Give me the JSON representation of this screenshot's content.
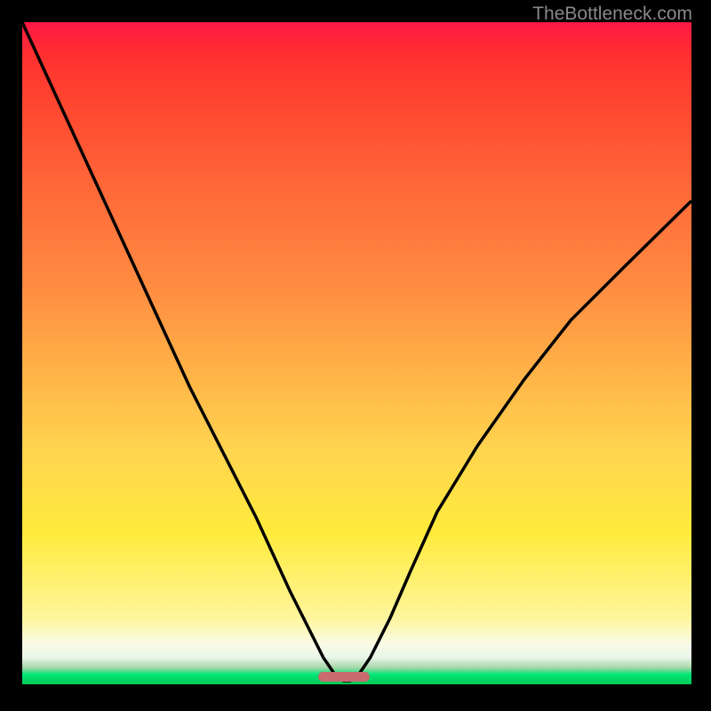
{
  "watermark": "TheBottleneck.com",
  "chart_data": {
    "type": "line",
    "title": "",
    "xlabel": "",
    "ylabel": "",
    "xlim": [
      0,
      100
    ],
    "ylim": [
      0,
      100
    ],
    "series": [
      {
        "name": "bottleneck-curve",
        "x": [
          0,
          5,
          10,
          15,
          20,
          25,
          30,
          35,
          40,
          43,
          45,
          47,
          48,
          49,
          50,
          52,
          55,
          58,
          62,
          68,
          75,
          82,
          90,
          100
        ],
        "values": [
          100,
          89,
          78,
          67,
          56,
          45,
          35,
          25,
          14,
          8,
          4,
          1,
          0.5,
          0.5,
          1,
          4,
          10,
          17,
          26,
          36,
          46,
          55,
          63,
          73
        ]
      }
    ],
    "marker": {
      "x_start": 44,
      "x_end": 52,
      "y": 0,
      "color": "#c96a6f"
    },
    "gradient_colors": {
      "top": "#ff1744",
      "middle": "#ffeb3b",
      "bottom": "#00c853"
    },
    "annotations": []
  }
}
